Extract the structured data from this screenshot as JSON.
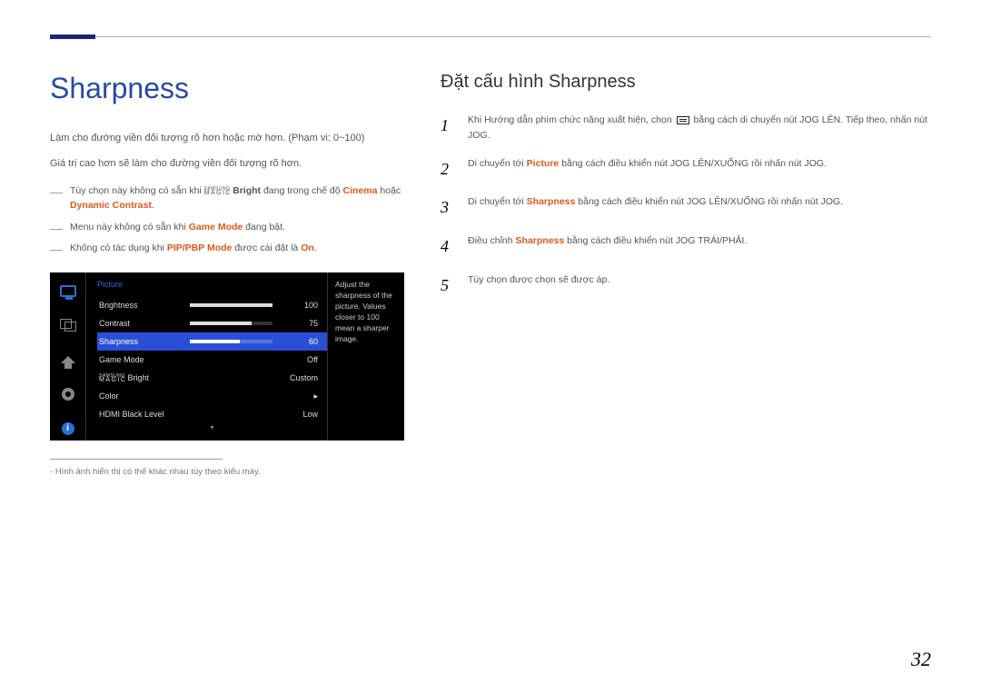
{
  "header": {
    "title": "Sharpness"
  },
  "left": {
    "p1": "Làm cho đường viền đối tượng rõ hơn hoặc mờ hơn. (Phạm vi: 0~100)",
    "p2": "Giá trị cao hơn sẽ làm cho đường viền đối tượng rõ hơn.",
    "note1a": "Tùy chọn này không có sẵn khi ",
    "note1_brand_top": "SAMSUNG",
    "note1_brand_bot": "MAGIC",
    "note1_bright": "Bright",
    "note1b": " đang trong chế độ ",
    "note1_cinema": "Cinema",
    "note1c": " hoặc ",
    "note1_dynamic": "Dynamic Contrast",
    "note1d": ".",
    "note2a": "Menu này không có sẵn khi ",
    "note2_game": "Game Mode",
    "note2b": " đang bật.",
    "note3a": "Không có tác dụng khi ",
    "note3_pip": "PIP/PBP Mode",
    "note3b": " được cài đặt là ",
    "note3_on": "On",
    "note3c": ".",
    "footnote": "Hình ảnh hiển thị có thể khác nhau tùy theo kiểu máy."
  },
  "osd": {
    "title": "Picture",
    "brightness": {
      "label": "Brightness",
      "value": "100",
      "pct": 100
    },
    "contrast": {
      "label": "Contrast",
      "value": "75",
      "pct": 75
    },
    "sharpness": {
      "label": "Sharpness",
      "value": "60",
      "pct": 60
    },
    "gamemode": {
      "label": "Game Mode",
      "value": "Off"
    },
    "magic": {
      "brand_top": "SAMSUNG",
      "brand_bot": "MAGIC",
      "label": "Bright",
      "value": "Custom"
    },
    "color": {
      "label": "Color",
      "value": "▸"
    },
    "hdmi": {
      "label": "HDMI Black Level",
      "value": "Low"
    },
    "help": "Adjust the sharpness of the picture. Values closer to 100 mean a sharper image."
  },
  "right": {
    "heading": "Đặt cấu hình Sharpness",
    "steps": {
      "s1": {
        "num": "1",
        "a": "Khi Hướng dẫn phím chức năng xuất hiện, chọn ",
        "b": " bằng cách di chuyển nút JOG LÊN. Tiếp theo, nhấn nút JOG."
      },
      "s2": {
        "num": "2",
        "a": "Di chuyển tới ",
        "hl": "Picture",
        "b": " bằng cách điều khiển nút JOG LÊN/XUỐNG rồi nhấn nút JOG."
      },
      "s3": {
        "num": "3",
        "a": "Di chuyển tới ",
        "hl": "Sharpness",
        "b": " bằng cách điều khiển nút JOG LÊN/XUỐNG rồi nhấn nút JOG."
      },
      "s4": {
        "num": "4",
        "a": "Điều chỉnh ",
        "hl": "Sharpness",
        "b": " bằng cách điều khiển nút JOG TRÁI/PHẢI."
      },
      "s5": {
        "num": "5",
        "a": "Tùy chọn được chọn sẽ được áp."
      }
    }
  },
  "page_number": "32"
}
